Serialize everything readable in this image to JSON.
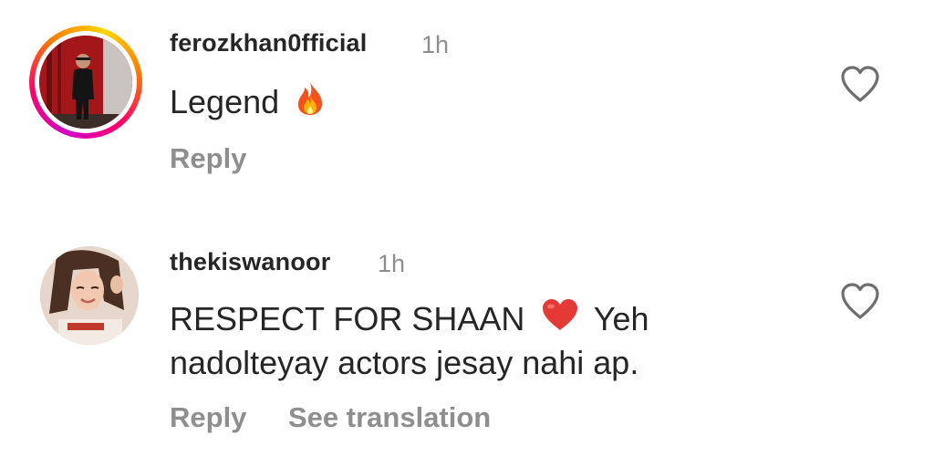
{
  "comments": [
    {
      "username": "ferozkhan0fficial",
      "time": "1h",
      "text": "Legend",
      "emoji": "fire-icon",
      "reply_label": "Reply"
    },
    {
      "username": "thekiswanoor",
      "time": "1h",
      "text_line1": "RESPECT FOR SHAAN",
      "text_line1_after": "Yeh",
      "text_line2": "nadolteyay actors jesay nahi ap.",
      "emoji": "red-heart-icon",
      "reply_label": "Reply",
      "translate_label": "See translation"
    }
  ],
  "colors": {
    "primary_text": "#262626",
    "secondary_text": "#8e8e8e",
    "heart_red": "#e53935"
  }
}
